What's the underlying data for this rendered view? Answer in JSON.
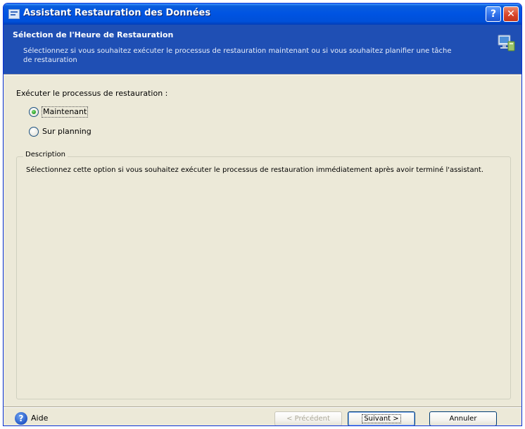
{
  "window": {
    "title": "Assistant Restauration des Données"
  },
  "titlebar": {
    "help_button": "?",
    "close_button": "✕"
  },
  "header": {
    "title": "Sélection de l'Heure de Restauration",
    "description": "Sélectionnez si vous souhaitez exécuter le processus de restauration maintenant ou si vous souhaitez planifier une tâche de restauration",
    "icon": "wizard-computer-icon"
  },
  "body": {
    "prompt": "Exécuter le processus de restauration :",
    "options": [
      {
        "label": "Maintenant",
        "checked": true
      },
      {
        "label": "Sur planning",
        "checked": false
      }
    ],
    "description_group": {
      "legend": "Description",
      "text": "Sélectionnez cette option si vous souhaitez exécuter le processus de restauration immédiatement après avoir terminé l'assistant."
    }
  },
  "footer": {
    "help_label": "Aide",
    "help_icon": "?",
    "buttons": {
      "previous": "< Précédent",
      "next": "Suivant >",
      "cancel": "Annuler"
    }
  },
  "colors": {
    "titlebar": "#0054E3",
    "header_band": "#1F4FB4",
    "window_bg": "#ECE9D8",
    "radio_checked": "#2FA52A"
  }
}
